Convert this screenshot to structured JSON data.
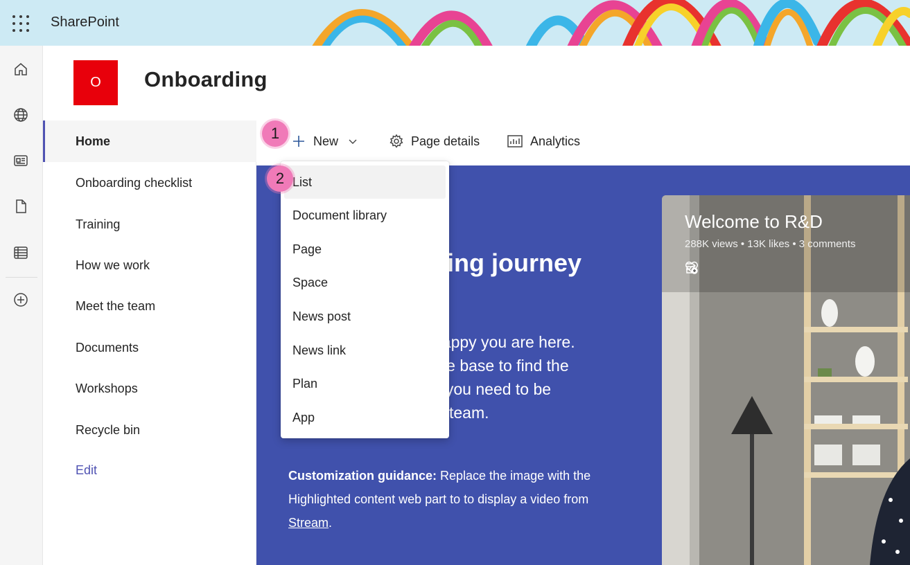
{
  "suite": {
    "app_name": "SharePoint"
  },
  "site": {
    "logo_letter": "O",
    "title": "Onboarding",
    "logo_color": "#e8000b"
  },
  "appbar": {
    "icons": [
      "home-icon",
      "globe-icon",
      "news-icon",
      "file-icon",
      "list-icon",
      "add-circle-icon"
    ]
  },
  "leftnav": {
    "items": [
      {
        "label": "Home",
        "active": true
      },
      {
        "label": "Onboarding checklist"
      },
      {
        "label": "Training"
      },
      {
        "label": "How we work"
      },
      {
        "label": "Meet the team"
      },
      {
        "label": "Documents"
      },
      {
        "label": "Workshops"
      },
      {
        "label": "Recycle bin"
      }
    ],
    "edit_label": "Edit"
  },
  "commandbar": {
    "new_label": "New",
    "page_details_label": "Page details",
    "analytics_label": "Analytics"
  },
  "new_menu": {
    "items": [
      "List",
      "Document library",
      "Page",
      "Space",
      "News post",
      "News link",
      "Plan",
      "App"
    ],
    "hovered": "List"
  },
  "steps": {
    "one": "1",
    "two": "2"
  },
  "hero": {
    "heading_visible": "ing journey",
    "body_lines": [
      "happy you are here.",
      "me base to find the",
      "s you need to be",
      "w team."
    ],
    "guidance_bold": "Customization guidance:",
    "guidance_text_1": " Replace the image with the",
    "guidance_text_2": "Highlighted content web part to to display a video from",
    "guidance_link": "Stream",
    "guidance_end": ".",
    "background_color": "#4051ac"
  },
  "video": {
    "title": "Welcome to R&D",
    "stats": "288K views • 13K likes • 3 comments"
  },
  "colors": {
    "accent": "#4f52b2",
    "badge": "#f07ab8"
  }
}
